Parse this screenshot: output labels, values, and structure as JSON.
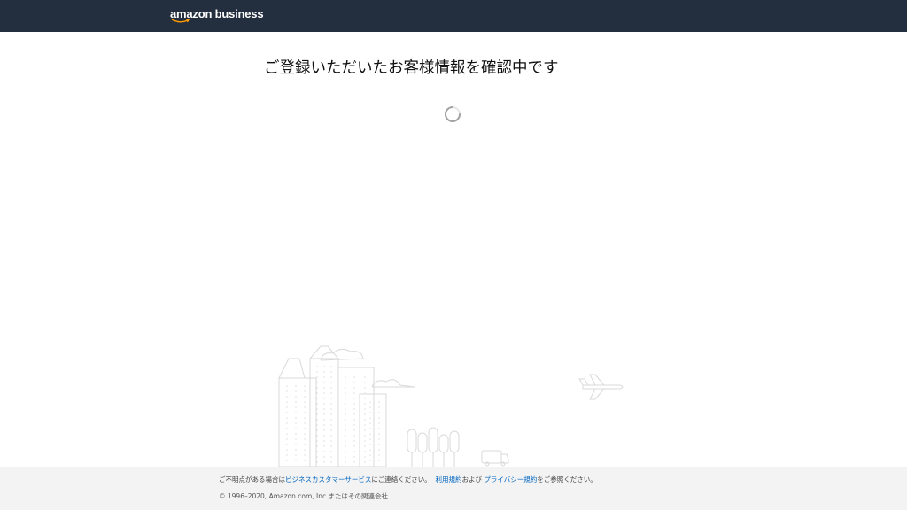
{
  "header": {
    "logo_text": "amazon business",
    "bg_color": "#232f3e"
  },
  "main": {
    "heading": "ご登録いただいたお客様情報を確認中です",
    "spinner_icon": "loading-spinner-icon"
  },
  "footer": {
    "line1_prefix": "ご不明点がある場合は",
    "customer_service_link": "ビジネスカスタマーサービス",
    "line1_middle": "にご連絡ください。",
    "terms_link": "利用規約",
    "and_text": "および",
    "privacy_link": "プライバシー規約",
    "line1_suffix": "をご参照ください。",
    "copyright": "© 1996–2020, Amazon.com, Inc.またはその関連会社",
    "link_color": "#0066c0"
  }
}
